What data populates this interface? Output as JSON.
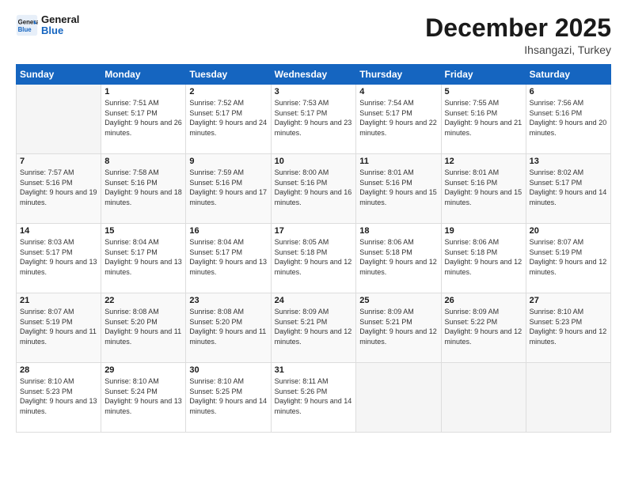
{
  "logo": {
    "line1": "General",
    "line2": "Blue"
  },
  "header": {
    "month": "December 2025",
    "location": "Ihsangazi, Turkey"
  },
  "weekdays": [
    "Sunday",
    "Monday",
    "Tuesday",
    "Wednesday",
    "Thursday",
    "Friday",
    "Saturday"
  ],
  "weeks": [
    [
      {
        "day": "",
        "sunrise": "",
        "sunset": "",
        "daylight": ""
      },
      {
        "day": "1",
        "sunrise": "Sunrise: 7:51 AM",
        "sunset": "Sunset: 5:17 PM",
        "daylight": "Daylight: 9 hours and 26 minutes."
      },
      {
        "day": "2",
        "sunrise": "Sunrise: 7:52 AM",
        "sunset": "Sunset: 5:17 PM",
        "daylight": "Daylight: 9 hours and 24 minutes."
      },
      {
        "day": "3",
        "sunrise": "Sunrise: 7:53 AM",
        "sunset": "Sunset: 5:17 PM",
        "daylight": "Daylight: 9 hours and 23 minutes."
      },
      {
        "day": "4",
        "sunrise": "Sunrise: 7:54 AM",
        "sunset": "Sunset: 5:17 PM",
        "daylight": "Daylight: 9 hours and 22 minutes."
      },
      {
        "day": "5",
        "sunrise": "Sunrise: 7:55 AM",
        "sunset": "Sunset: 5:16 PM",
        "daylight": "Daylight: 9 hours and 21 minutes."
      },
      {
        "day": "6",
        "sunrise": "Sunrise: 7:56 AM",
        "sunset": "Sunset: 5:16 PM",
        "daylight": "Daylight: 9 hours and 20 minutes."
      }
    ],
    [
      {
        "day": "7",
        "sunrise": "Sunrise: 7:57 AM",
        "sunset": "Sunset: 5:16 PM",
        "daylight": "Daylight: 9 hours and 19 minutes."
      },
      {
        "day": "8",
        "sunrise": "Sunrise: 7:58 AM",
        "sunset": "Sunset: 5:16 PM",
        "daylight": "Daylight: 9 hours and 18 minutes."
      },
      {
        "day": "9",
        "sunrise": "Sunrise: 7:59 AM",
        "sunset": "Sunset: 5:16 PM",
        "daylight": "Daylight: 9 hours and 17 minutes."
      },
      {
        "day": "10",
        "sunrise": "Sunrise: 8:00 AM",
        "sunset": "Sunset: 5:16 PM",
        "daylight": "Daylight: 9 hours and 16 minutes."
      },
      {
        "day": "11",
        "sunrise": "Sunrise: 8:01 AM",
        "sunset": "Sunset: 5:16 PM",
        "daylight": "Daylight: 9 hours and 15 minutes."
      },
      {
        "day": "12",
        "sunrise": "Sunrise: 8:01 AM",
        "sunset": "Sunset: 5:16 PM",
        "daylight": "Daylight: 9 hours and 15 minutes."
      },
      {
        "day": "13",
        "sunrise": "Sunrise: 8:02 AM",
        "sunset": "Sunset: 5:17 PM",
        "daylight": "Daylight: 9 hours and 14 minutes."
      }
    ],
    [
      {
        "day": "14",
        "sunrise": "Sunrise: 8:03 AM",
        "sunset": "Sunset: 5:17 PM",
        "daylight": "Daylight: 9 hours and 13 minutes."
      },
      {
        "day": "15",
        "sunrise": "Sunrise: 8:04 AM",
        "sunset": "Sunset: 5:17 PM",
        "daylight": "Daylight: 9 hours and 13 minutes."
      },
      {
        "day": "16",
        "sunrise": "Sunrise: 8:04 AM",
        "sunset": "Sunset: 5:17 PM",
        "daylight": "Daylight: 9 hours and 13 minutes."
      },
      {
        "day": "17",
        "sunrise": "Sunrise: 8:05 AM",
        "sunset": "Sunset: 5:18 PM",
        "daylight": "Daylight: 9 hours and 12 minutes."
      },
      {
        "day": "18",
        "sunrise": "Sunrise: 8:06 AM",
        "sunset": "Sunset: 5:18 PM",
        "daylight": "Daylight: 9 hours and 12 minutes."
      },
      {
        "day": "19",
        "sunrise": "Sunrise: 8:06 AM",
        "sunset": "Sunset: 5:18 PM",
        "daylight": "Daylight: 9 hours and 12 minutes."
      },
      {
        "day": "20",
        "sunrise": "Sunrise: 8:07 AM",
        "sunset": "Sunset: 5:19 PM",
        "daylight": "Daylight: 9 hours and 12 minutes."
      }
    ],
    [
      {
        "day": "21",
        "sunrise": "Sunrise: 8:07 AM",
        "sunset": "Sunset: 5:19 PM",
        "daylight": "Daylight: 9 hours and 11 minutes."
      },
      {
        "day": "22",
        "sunrise": "Sunrise: 8:08 AM",
        "sunset": "Sunset: 5:20 PM",
        "daylight": "Daylight: 9 hours and 11 minutes."
      },
      {
        "day": "23",
        "sunrise": "Sunrise: 8:08 AM",
        "sunset": "Sunset: 5:20 PM",
        "daylight": "Daylight: 9 hours and 11 minutes."
      },
      {
        "day": "24",
        "sunrise": "Sunrise: 8:09 AM",
        "sunset": "Sunset: 5:21 PM",
        "daylight": "Daylight: 9 hours and 12 minutes."
      },
      {
        "day": "25",
        "sunrise": "Sunrise: 8:09 AM",
        "sunset": "Sunset: 5:21 PM",
        "daylight": "Daylight: 9 hours and 12 minutes."
      },
      {
        "day": "26",
        "sunrise": "Sunrise: 8:09 AM",
        "sunset": "Sunset: 5:22 PM",
        "daylight": "Daylight: 9 hours and 12 minutes."
      },
      {
        "day": "27",
        "sunrise": "Sunrise: 8:10 AM",
        "sunset": "Sunset: 5:23 PM",
        "daylight": "Daylight: 9 hours and 12 minutes."
      }
    ],
    [
      {
        "day": "28",
        "sunrise": "Sunrise: 8:10 AM",
        "sunset": "Sunset: 5:23 PM",
        "daylight": "Daylight: 9 hours and 13 minutes."
      },
      {
        "day": "29",
        "sunrise": "Sunrise: 8:10 AM",
        "sunset": "Sunset: 5:24 PM",
        "daylight": "Daylight: 9 hours and 13 minutes."
      },
      {
        "day": "30",
        "sunrise": "Sunrise: 8:10 AM",
        "sunset": "Sunset: 5:25 PM",
        "daylight": "Daylight: 9 hours and 14 minutes."
      },
      {
        "day": "31",
        "sunrise": "Sunrise: 8:11 AM",
        "sunset": "Sunset: 5:26 PM",
        "daylight": "Daylight: 9 hours and 14 minutes."
      },
      {
        "day": "",
        "sunrise": "",
        "sunset": "",
        "daylight": ""
      },
      {
        "day": "",
        "sunrise": "",
        "sunset": "",
        "daylight": ""
      },
      {
        "day": "",
        "sunrise": "",
        "sunset": "",
        "daylight": ""
      }
    ]
  ]
}
